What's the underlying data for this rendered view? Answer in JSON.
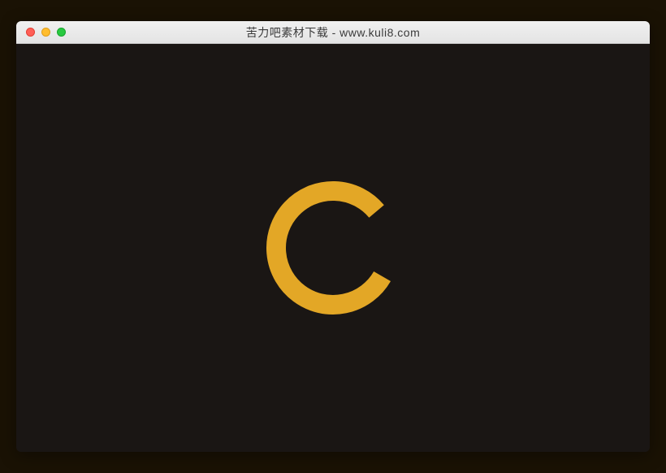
{
  "window": {
    "title": "苦力吧素材下载 - www.kuli8.com"
  },
  "spinner": {
    "color": "#e3a726",
    "background": "#1a1614",
    "stroke_width": 24,
    "radius": 70,
    "arc_start_deg": 30,
    "arc_sweep_deg": 290
  }
}
